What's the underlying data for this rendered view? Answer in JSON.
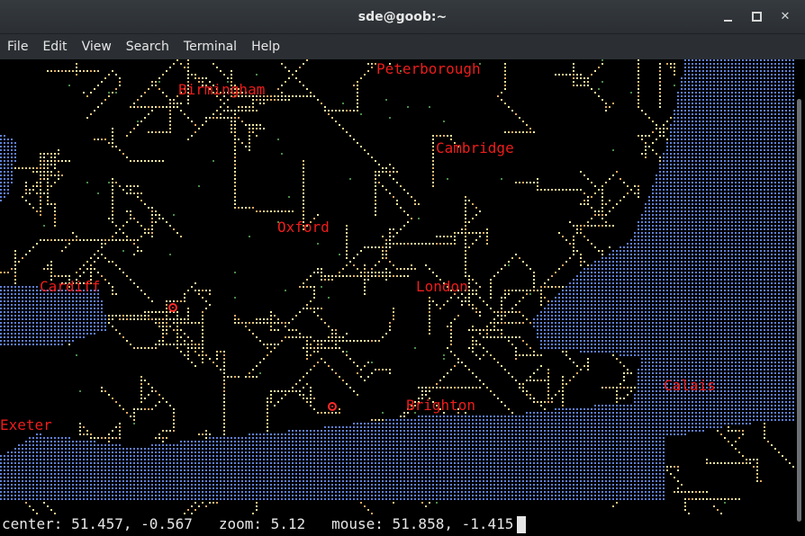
{
  "window": {
    "title": "sde@goob:~",
    "minimize_icon": "minimize-icon",
    "maximize_icon": "maximize-icon",
    "close_glyph": "✕"
  },
  "menu": {
    "items": [
      "File",
      "Edit",
      "View",
      "Search",
      "Terminal",
      "Help"
    ]
  },
  "map": {
    "cities": [
      {
        "name": "Peterborough"
      },
      {
        "name": "Birmingham"
      },
      {
        "name": "Cambridge"
      },
      {
        "name": "Oxford"
      },
      {
        "name": "Cardiff"
      },
      {
        "name": "London"
      },
      {
        "name": "Calais"
      },
      {
        "name": "Brighton"
      },
      {
        "name": "Exeter"
      }
    ],
    "colors": {
      "sea": "#5e7fd6",
      "road_light": "#f0e6a0",
      "road_mid": "#e2c880",
      "road_orange": "#e0a860",
      "park": "#4a8a4a",
      "label": "#ee1c1c"
    }
  },
  "status": {
    "center_label": "center:",
    "center_value": "51.457, -0.567",
    "zoom_label": "zoom:",
    "zoom_value": "5.12",
    "mouse_label": "mouse:",
    "mouse_value": "51.858, -1.415"
  }
}
